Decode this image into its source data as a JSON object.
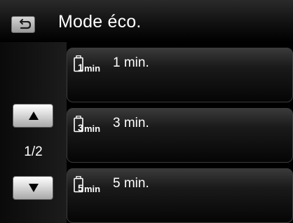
{
  "header": {
    "title": "Mode éco."
  },
  "pagination": {
    "indicator": "1/2"
  },
  "options": [
    {
      "icon_num": "1",
      "icon_unit": "min",
      "label": "1 min."
    },
    {
      "icon_num": "3",
      "icon_unit": "min",
      "label": "3 min."
    },
    {
      "icon_num": "5",
      "icon_unit": "min",
      "label": "5 min."
    }
  ],
  "icons": {
    "back": "back-arrow-icon",
    "up": "triangle-up-icon",
    "down": "triangle-down-icon",
    "option": "battery-icon"
  }
}
